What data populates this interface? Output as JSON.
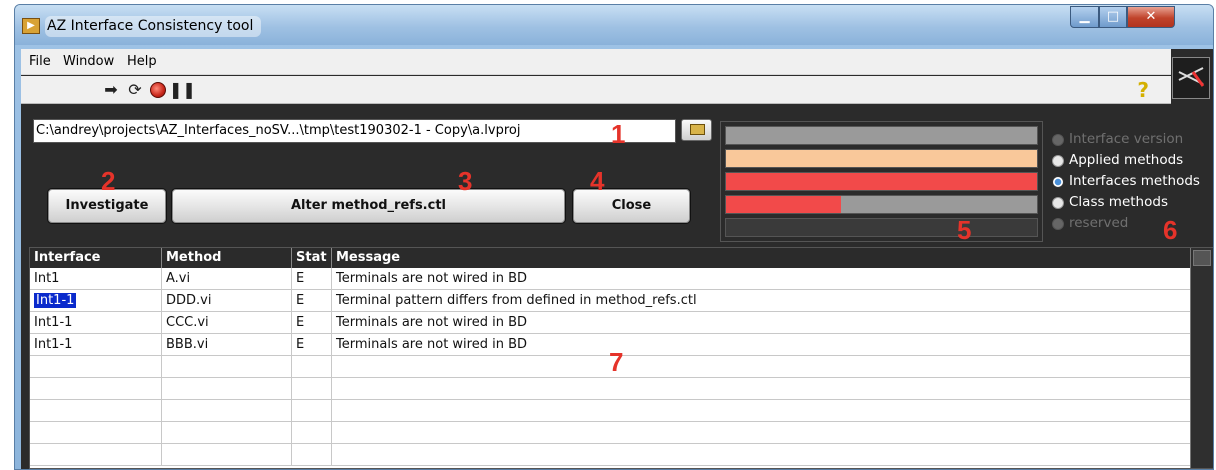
{
  "window": {
    "title": "AZ Interface Consistency tool"
  },
  "menu": [
    "File",
    "Window",
    "Help"
  ],
  "path": {
    "value": "C:\\andrey\\projects\\AZ_Interfaces_noSV...\\tmp\\test190302-1 - Copy\\a.lvproj"
  },
  "buttons": {
    "investigate": "Investigate",
    "alter": "Alter method_refs.ctl",
    "close": "Close"
  },
  "annotations": [
    "1",
    "2",
    "3",
    "4",
    "5",
    "6",
    "7"
  ],
  "colors": {
    "bar_gray": "#9a9a9a",
    "bar_peach": "#f9c89a",
    "bar_red": "#f24a4a",
    "selected_bg": "#0a2acc"
  },
  "bars": [
    {
      "color": "gray",
      "fill": 1.0
    },
    {
      "color": "peach",
      "fill": 1.0
    },
    {
      "color": "red",
      "fill": 1.0
    },
    {
      "color": "red-on-gray",
      "fill": 0.37
    },
    {
      "color": "none",
      "fill": 0.0
    }
  ],
  "radio": {
    "options": [
      {
        "label": "Interface version",
        "state": "disabled"
      },
      {
        "label": "Applied methods",
        "state": "enabled"
      },
      {
        "label": "Interfaces methods",
        "state": "selected"
      },
      {
        "label": "Class methods",
        "state": "enabled"
      },
      {
        "label": "reserved",
        "state": "disabled"
      }
    ]
  },
  "table": {
    "headers": [
      "Interface",
      "Method",
      "Stat",
      "Message"
    ],
    "rows": [
      [
        "Int1",
        "A.vi",
        "E",
        "Terminals are not wired in BD"
      ],
      [
        "Int1-1",
        "DDD.vi",
        "E",
        "Terminal pattern differs from defined in method_refs.ctl"
      ],
      [
        "Int1-1",
        "CCC.vi",
        "E",
        "Terminals are not wired in BD"
      ],
      [
        "Int1-1",
        "BBB.vi",
        "E",
        "Terminals are not wired in BD"
      ],
      [
        "",
        "",
        "",
        ""
      ],
      [
        "",
        "",
        "",
        ""
      ],
      [
        "",
        "",
        "",
        ""
      ],
      [
        "",
        "",
        "",
        ""
      ],
      [
        "",
        "",
        "",
        ""
      ]
    ],
    "selected_cell": [
      1,
      0
    ]
  },
  "icons": [
    "run-arrow-icon",
    "run-continuous-icon",
    "abort-icon",
    "pause-icon",
    "help-icon",
    "folder-icon"
  ]
}
